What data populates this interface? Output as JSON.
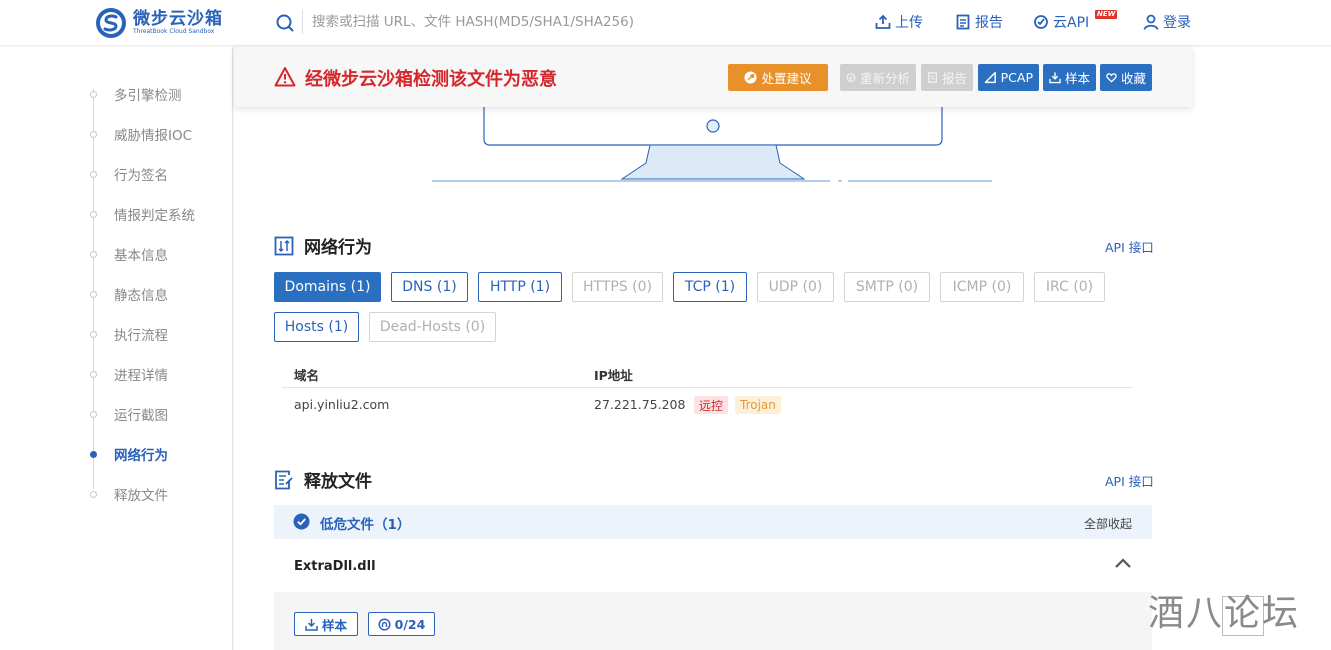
{
  "header": {
    "logo_cn": "微步云沙箱",
    "logo_en": "ThreatBook Cloud Sandbox",
    "search_placeholder": "搜索或扫描 URL、文件 HASH(MD5/SHA1/SHA256)",
    "nav": {
      "upload": "上传",
      "report": "报告",
      "api": "云API",
      "new_badge": "NEW",
      "login": "登录"
    }
  },
  "sidebar": {
    "items": [
      {
        "label": "多引擎检测"
      },
      {
        "label": "威胁情报IOC"
      },
      {
        "label": "行为签名"
      },
      {
        "label": "情报判定系统"
      },
      {
        "label": "基本信息"
      },
      {
        "label": "静态信息"
      },
      {
        "label": "执行流程"
      },
      {
        "label": "进程详情"
      },
      {
        "label": "运行截图"
      },
      {
        "label": "网络行为",
        "active": true
      },
      {
        "label": "释放文件"
      }
    ]
  },
  "alert": {
    "text": "经微步云沙箱检测该文件为恶意",
    "buttons": {
      "advice": "处置建议",
      "reanalyze": "重新分析",
      "report": "报告",
      "pcap": "PCAP",
      "sample": "样本",
      "favorite": "收藏"
    }
  },
  "network": {
    "title": "网络行为",
    "api_link": "API 接口",
    "tabs": [
      {
        "label": "Domains (1)",
        "state": "active"
      },
      {
        "label": "DNS (1)",
        "state": "normal"
      },
      {
        "label": "HTTP (1)",
        "state": "normal"
      },
      {
        "label": "HTTPS (0)",
        "state": "disabled"
      },
      {
        "label": "TCP (1)",
        "state": "normal"
      },
      {
        "label": "UDP (0)",
        "state": "disabled"
      },
      {
        "label": "SMTP (0)",
        "state": "disabled"
      },
      {
        "label": "ICMP (0)",
        "state": "disabled"
      },
      {
        "label": "IRC (0)",
        "state": "disabled"
      },
      {
        "label": "Hosts (1)",
        "state": "normal"
      },
      {
        "label": "Dead-Hosts (0)",
        "state": "disabled"
      }
    ],
    "table": {
      "columns": [
        "域名",
        "IP地址"
      ],
      "rows": [
        {
          "domain": "api.yinliu2.com",
          "ip": "27.221.75.208",
          "tags": [
            "远控",
            "Trojan"
          ]
        }
      ]
    }
  },
  "released": {
    "title": "释放文件",
    "api_link": "API 接口",
    "group_label": "低危文件（1）",
    "collapse_all": "全部收起",
    "file_name": "ExtraDll.dll",
    "sample_button": "样本",
    "detection_button": "0/24"
  },
  "watermark": "酒八论坛",
  "colors": {
    "brand": "#2a62b9",
    "danger": "#d4282d",
    "warning": "#e8912b"
  }
}
